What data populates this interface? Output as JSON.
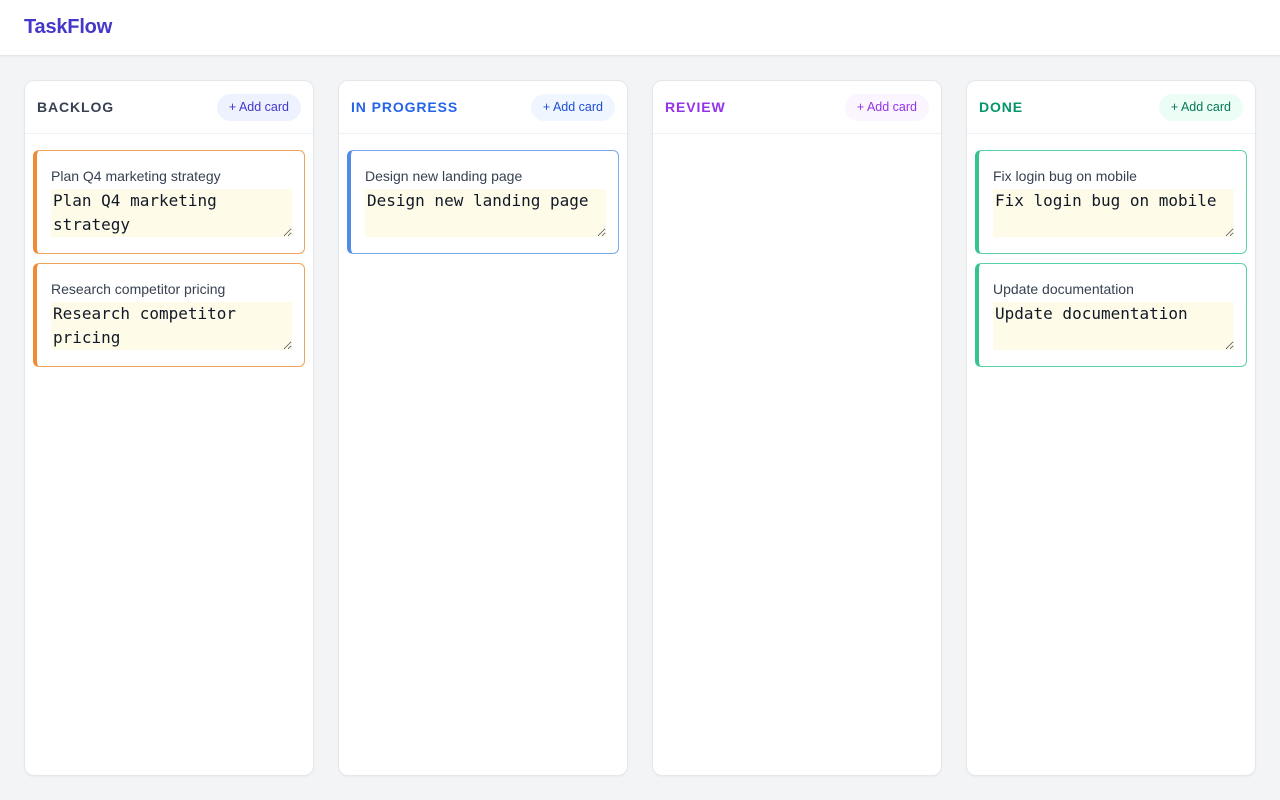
{
  "app": {
    "brand": "TaskFlow"
  },
  "add_label": "+ Add card",
  "columns": [
    {
      "title": "BACKLOG",
      "title_color": "#374151",
      "btn_bg": "#eef2ff",
      "btn_color": "#4338ca",
      "card_border": "#f0a45d",
      "card_accent": "#f08a35",
      "cards": [
        {
          "title": "Plan Q4 marketing strategy",
          "text": "Plan Q4 marketing strategy"
        },
        {
          "title": "Research competitor pricing",
          "text": "Research competitor pricing"
        }
      ]
    },
    {
      "title": "IN PROGRESS",
      "title_color": "#2563eb",
      "btn_bg": "#eff6ff",
      "btn_color": "#1d4ed8",
      "card_border": "#7aa7ef",
      "card_accent": "#4f8ce8",
      "cards": [
        {
          "title": "Design new landing page",
          "text": "Design new landing page"
        }
      ]
    },
    {
      "title": "REVIEW",
      "title_color": "#9333ea",
      "btn_bg": "#faf5ff",
      "btn_color": "#9333ea",
      "card_border": "#c084fc",
      "card_accent": "#a855f7",
      "cards": []
    },
    {
      "title": "DONE",
      "title_color": "#059669",
      "btn_bg": "#ecfdf5",
      "btn_color": "#047857",
      "card_border": "#5cd3a6",
      "card_accent": "#34c48e",
      "cards": [
        {
          "title": "Fix login bug on mobile",
          "text": "Fix login bug on mobile"
        },
        {
          "title": "Update documentation",
          "text": "Update documentation"
        }
      ]
    }
  ]
}
